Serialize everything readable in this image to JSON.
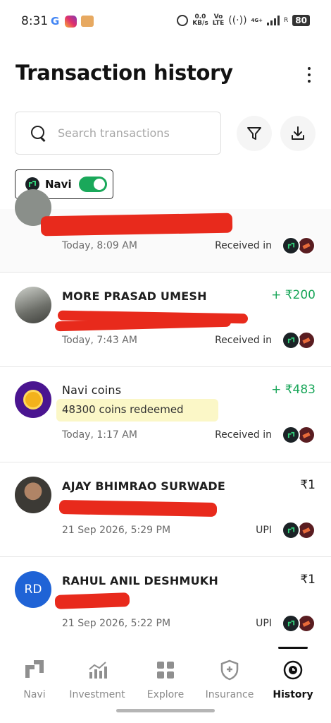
{
  "status_bar": {
    "time": "8:31",
    "g_icon": "G",
    "speed_value": "0.0",
    "speed_unit": "KB/s",
    "network_top": "Vo",
    "network_bottom": "LTE",
    "signal_label": "4G+",
    "roaming": "R",
    "battery": "80"
  },
  "header": {
    "title": "Transaction history",
    "more_icon": "more-vertical-icon"
  },
  "search": {
    "placeholder": "Search transactions",
    "value": ""
  },
  "actions": {
    "filter_icon": "filter-icon",
    "download_icon": "download-icon"
  },
  "filter_chip": {
    "label": "Navi",
    "toggle_on": true
  },
  "transactions": [
    {
      "name": "",
      "date": "Today, 8:09 AM",
      "mode": "Received in",
      "amount": ""
    },
    {
      "name": "MORE PRASAD UMESH",
      "date": "Today, 7:43 AM",
      "mode": "Received in",
      "amount": "+ ₹200"
    },
    {
      "name": "Navi coins",
      "subtitle": "48300 coins redeemed",
      "date": "Today, 1:17 AM",
      "mode": "Received in",
      "amount": "+ ₹483"
    },
    {
      "name": "AJAY BHIMRAO SURWADE",
      "date": "21 Sep 2026, 5:29 PM",
      "mode": "UPI",
      "amount": "₹1"
    },
    {
      "name": "RAHUL ANIL DESHMUKH",
      "initials": "RD",
      "date": "21 Sep 2026, 5:22 PM",
      "mode": "UPI",
      "amount": "₹1"
    }
  ],
  "bottom_nav": {
    "items": [
      {
        "label": "Navi",
        "icon": "navi-logo-icon"
      },
      {
        "label": "Investment",
        "icon": "chart-bars-icon"
      },
      {
        "label": "Explore",
        "icon": "grid-icon"
      },
      {
        "label": "Insurance",
        "icon": "shield-plus-icon"
      },
      {
        "label": "History",
        "icon": "history-clock-icon"
      }
    ],
    "active": "History"
  },
  "colors": {
    "credit_green": "#19a659",
    "toggle_green": "#1aa85a",
    "coin_purple": "#4a1590",
    "avatar_blue": "#1f63d6",
    "redaction_red": "#e82a1c"
  }
}
